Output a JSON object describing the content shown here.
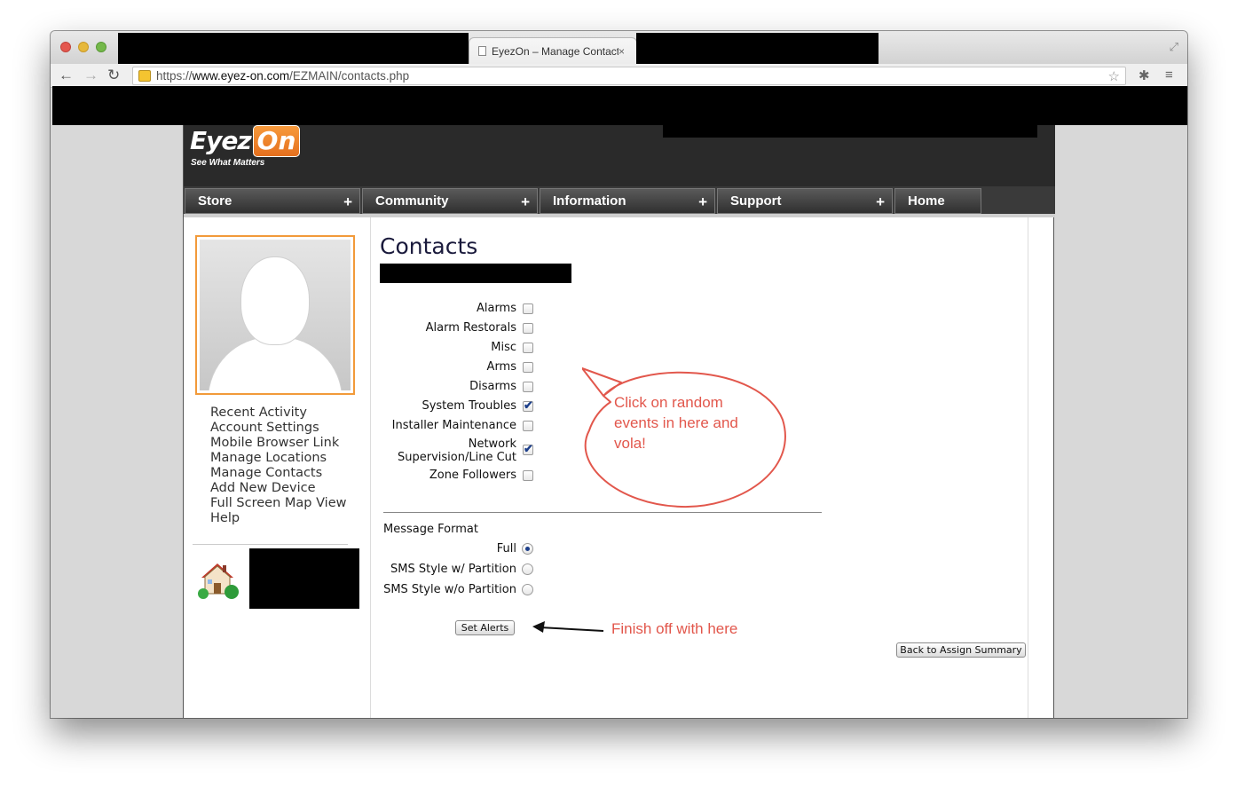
{
  "browser": {
    "tab_title": "EyezOn – Manage Contact",
    "tab_close": "×",
    "url_scheme": "https://",
    "url_host": "www.eyez-on.com",
    "url_path": "/EZMAIN/contacts.php"
  },
  "logo": {
    "eyez": "Eyez",
    "on": "On",
    "tagline": "See What Matters"
  },
  "menu": {
    "items": [
      {
        "label": "Store",
        "plus": "+"
      },
      {
        "label": "Community",
        "plus": "+"
      },
      {
        "label": "Information",
        "plus": "+"
      },
      {
        "label": "Support",
        "plus": "+"
      },
      {
        "label": "Home"
      }
    ]
  },
  "sidebar": {
    "links": [
      "Recent Activity",
      "Account Settings",
      "Mobile Browser Link",
      "Manage Locations",
      "Manage Contacts",
      "Add New Device",
      "Full Screen Map View",
      "Help"
    ]
  },
  "page": {
    "title": "Contacts",
    "events": [
      {
        "label": "Alarms",
        "checked": false
      },
      {
        "label": "Alarm Restorals",
        "checked": false
      },
      {
        "label": "Misc",
        "checked": false
      },
      {
        "label": "Arms",
        "checked": false
      },
      {
        "label": "Disarms",
        "checked": false
      },
      {
        "label": "System Troubles",
        "checked": true
      },
      {
        "label": "Installer Maintenance",
        "checked": false
      },
      {
        "label_line1": "Network",
        "label_line2": "Supervision/Line Cut",
        "checked": true
      },
      {
        "label": "Zone Followers",
        "checked": false
      }
    ],
    "message_format_label": "Message Format",
    "formats": [
      {
        "label": "Full",
        "selected": true
      },
      {
        "label": "SMS Style w/ Partition",
        "selected": false
      },
      {
        "label": "SMS Style w/o Partition",
        "selected": false
      }
    ],
    "set_alerts_button": "Set Alerts",
    "back_button": "Back to Assign Summary"
  },
  "annotations": {
    "bubble": "Click on random events in here and vola!",
    "finish": "Finish off with here",
    "color": "#e2574c"
  }
}
